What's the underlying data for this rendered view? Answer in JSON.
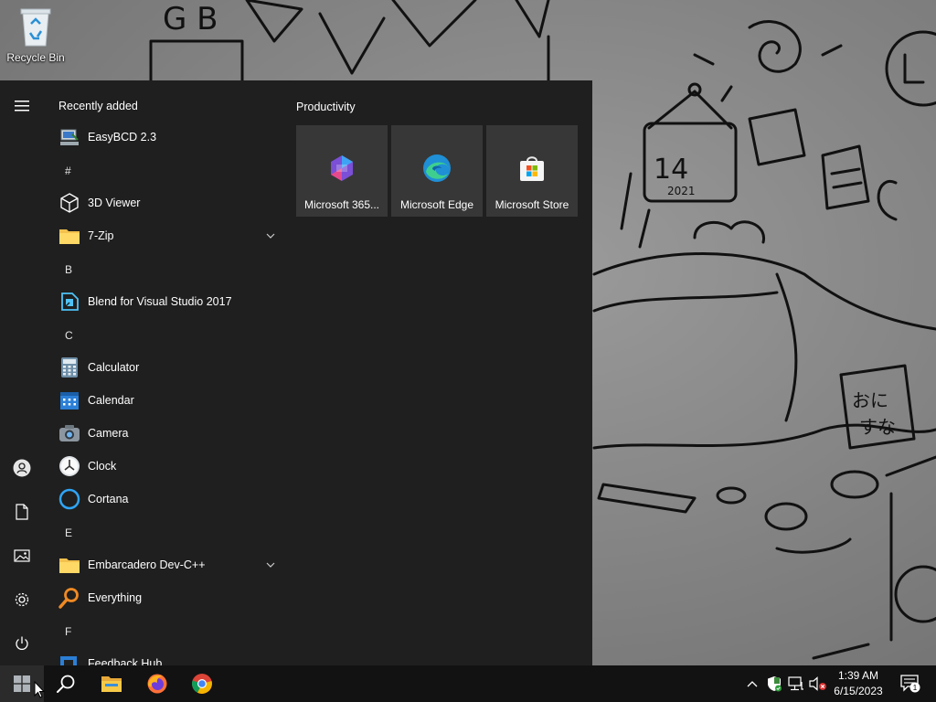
{
  "desktop": {
    "icons": [
      {
        "label": "Recycle Bin",
        "icon": "recycle-bin-icon"
      }
    ]
  },
  "start_menu": {
    "rail": [
      {
        "name": "expand",
        "icon": "hamburger-menu-icon"
      },
      {
        "name": "account",
        "icon": "user-account-icon"
      },
      {
        "name": "documents",
        "icon": "document-icon"
      },
      {
        "name": "pictures",
        "icon": "pictures-icon"
      },
      {
        "name": "settings",
        "icon": "gear-icon"
      },
      {
        "name": "power",
        "icon": "power-icon"
      }
    ],
    "recently_added_heading": "Recently added",
    "letters": {
      "hash": "#",
      "b": "B",
      "c": "C",
      "e": "E",
      "f": "F"
    },
    "apps": {
      "easybcd": "EasyBCD 2.3",
      "viewer3d": "3D Viewer",
      "zip7": "7-Zip",
      "blend": "Blend for Visual Studio 2017",
      "calculator": "Calculator",
      "calendar": "Calendar",
      "camera": "Camera",
      "clock": "Clock",
      "cortana": "Cortana",
      "devcpp": "Embarcadero Dev-C++",
      "everything": "Everything",
      "feedback": "Feedback Hub"
    },
    "tile_group": {
      "title": "Productivity",
      "tiles": [
        {
          "label": "Microsoft 365...",
          "icon": "microsoft-365-icon"
        },
        {
          "label": "Microsoft Edge",
          "icon": "edge-icon"
        },
        {
          "label": "Microsoft Store",
          "icon": "store-icon"
        }
      ]
    }
  },
  "taskbar": {
    "pinned": [
      {
        "name": "start",
        "icon": "windows-logo-icon"
      },
      {
        "name": "search",
        "icon": "search-icon"
      },
      {
        "name": "file-explorer",
        "icon": "folder-icon"
      },
      {
        "name": "firefox",
        "icon": "firefox-icon"
      },
      {
        "name": "chrome",
        "icon": "chrome-icon"
      }
    ],
    "tray": [
      {
        "name": "show-hidden-icons",
        "icon": "chevron-up-icon"
      },
      {
        "name": "security",
        "icon": "shield-icon"
      },
      {
        "name": "network",
        "icon": "network-icon"
      },
      {
        "name": "volume",
        "icon": "volume-muted-icon"
      }
    ],
    "clock": {
      "time": "1:39 AM",
      "date": "6/15/2023"
    },
    "notifications": {
      "count": "1",
      "icon": "notification-center-icon"
    }
  }
}
